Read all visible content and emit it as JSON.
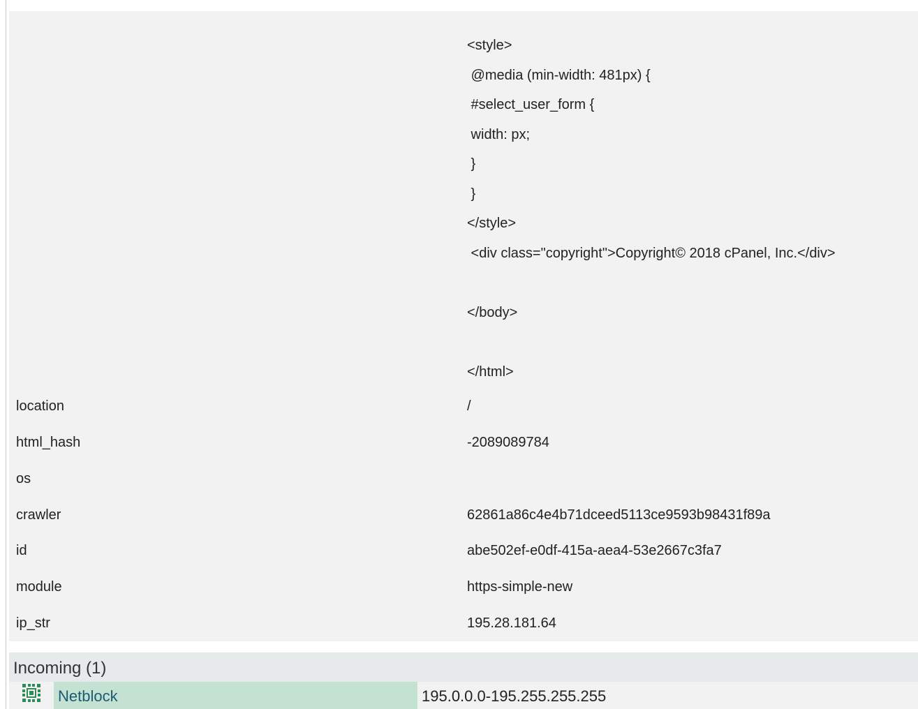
{
  "html_banner_lines": [
    "<style>",
    " @media (min-width: 481px) {",
    " #select_user_form {",
    " width: px;",
    " }",
    " }",
    "</style>",
    " <div class=\"copyright\">Copyright© 2018 cPanel, Inc.</div>",
    "</body>",
    "</html>"
  ],
  "properties": [
    {
      "key": "location",
      "value": "/"
    },
    {
      "key": "html_hash",
      "value": "-2089089784"
    },
    {
      "key": "os",
      "value": ""
    },
    {
      "key": "crawler",
      "value": "62861a86c4e4b71dceed5113ce9593b98431f89a"
    },
    {
      "key": "id",
      "value": "abe502ef-e0df-415a-aea4-53e2667c3fa7"
    },
    {
      "key": "module",
      "value": "https-simple-new"
    },
    {
      "key": "ip_str",
      "value": "195.28.181.64"
    }
  ],
  "incoming": {
    "title": "Incoming (1)",
    "items": [
      {
        "icon": "netblock-icon",
        "type": "Netblock",
        "value": "195.0.0.0-195.255.255.255"
      }
    ]
  },
  "colors": {
    "panel_bg": "#f2f2f2",
    "header_bg": "#e6eaeb",
    "netblock_bg": "#c4e2d1",
    "netblock_text": "#1e5a73",
    "icon_green": "#2e8b57"
  }
}
